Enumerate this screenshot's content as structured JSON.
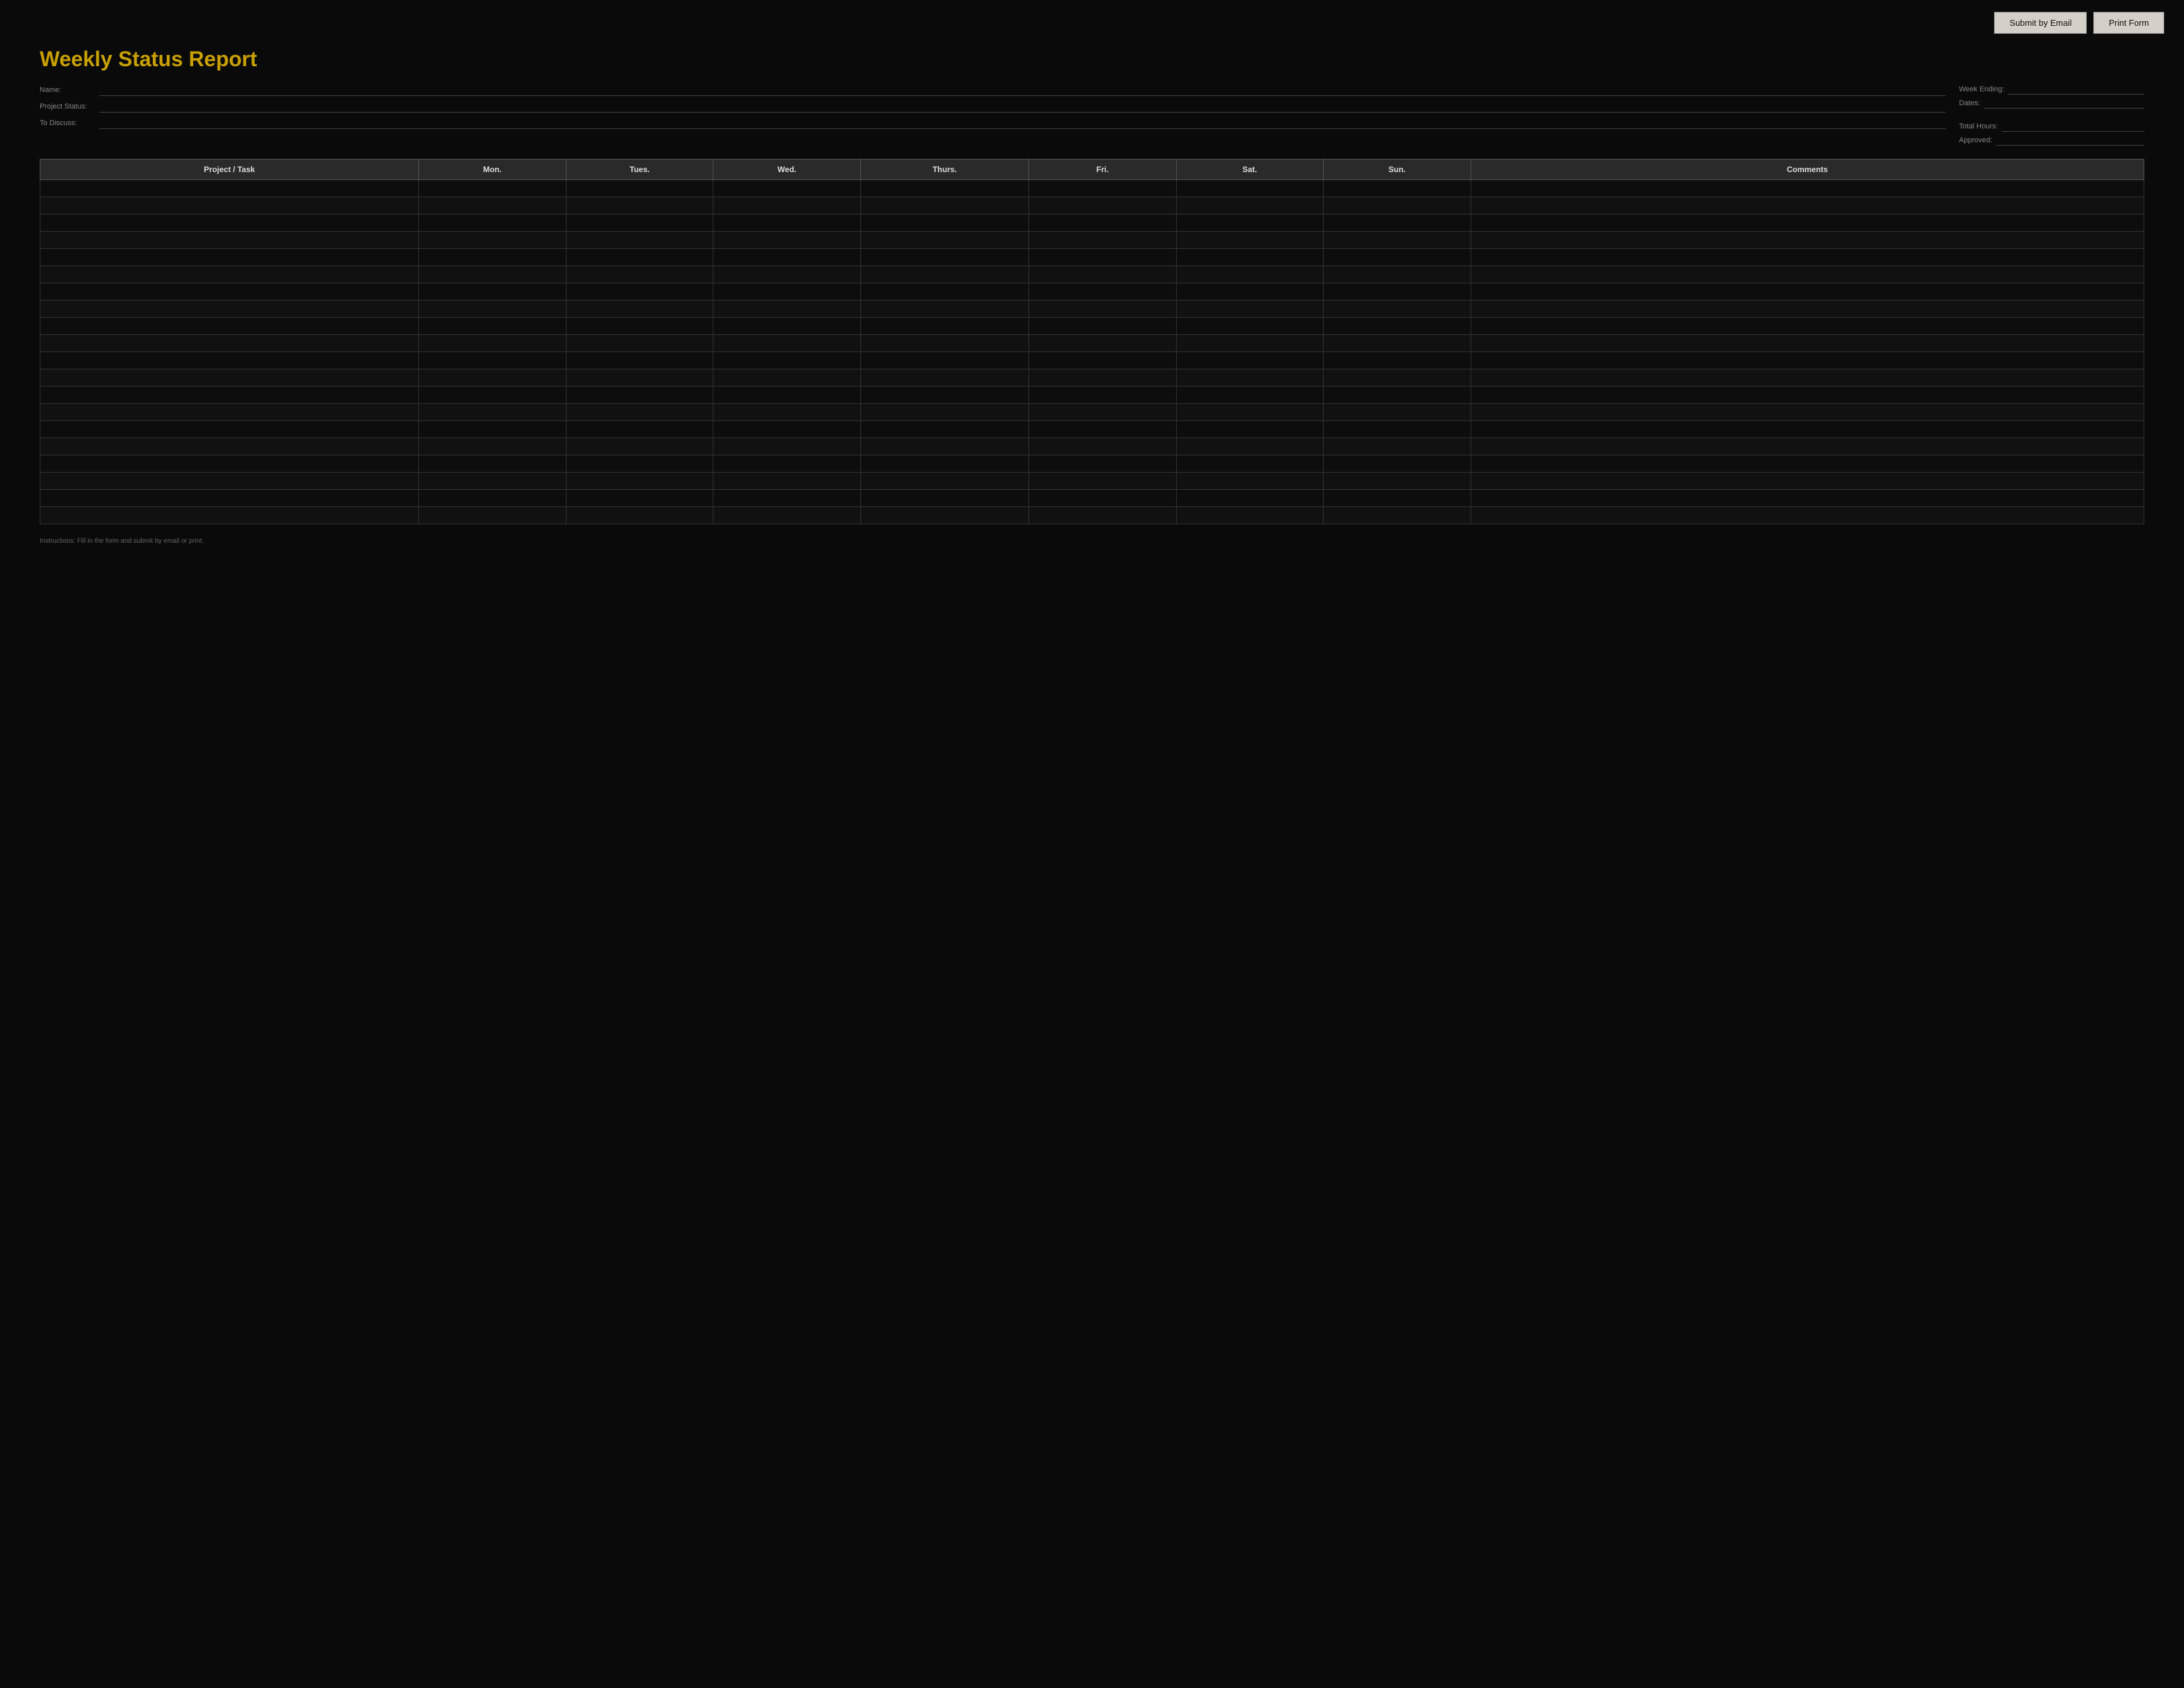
{
  "header": {
    "submit_email_label": "Submit by Email",
    "print_form_label": "Print Form"
  },
  "form": {
    "title": "Weekly Status Report",
    "fields": {
      "name_label": "Name:",
      "project_status_label": "Project Status:",
      "to_discuss_label": "To Discuss:"
    },
    "right_fields": {
      "week_ending_label": "Week Ending:",
      "dates_label": "Dates:",
      "total_hours_label": "Total Hours:",
      "approved_label": "Approved:"
    }
  },
  "table": {
    "headers": [
      "Project / Task",
      "Mon.",
      "Tues.",
      "Wed.",
      "Thurs.",
      "Fri.",
      "Sat.",
      "Sun.",
      "Comments"
    ],
    "num_rows": 20
  },
  "footer": {
    "note": "Instructions: Fill in the form and submit by email or print."
  }
}
